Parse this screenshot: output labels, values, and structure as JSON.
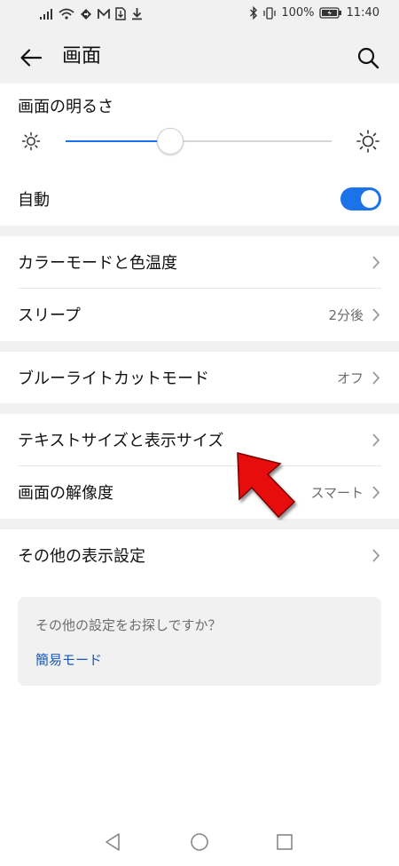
{
  "status_bar": {
    "battery_percent": "100%",
    "time": "11:40",
    "icons": [
      "signal-icon",
      "wifi-icon",
      "direction-icon",
      "mail-icon",
      "sim-icon",
      "download-icon",
      "bluetooth-icon",
      "vibrate-icon",
      "battery-icon"
    ]
  },
  "app_bar": {
    "title": "画面",
    "icons": {
      "back": "back-arrow-icon",
      "search": "search-icon"
    }
  },
  "brightness": {
    "label": "画面の明るさ",
    "slider_value_fraction": 0.39
  },
  "auto": {
    "label": "自動",
    "toggle_on": true
  },
  "sections": {
    "color": {
      "label": "カラーモードと色温度"
    },
    "sleep": {
      "label": "スリープ",
      "value": "2分後"
    },
    "bluelight": {
      "label": "ブルーライトカットモード",
      "value": "オフ"
    },
    "textsize": {
      "label": "テキストサイズと表示サイズ"
    },
    "resolution": {
      "label": "画面の解像度",
      "value": "スマート"
    },
    "other": {
      "label": "その他の表示設定"
    }
  },
  "suggestion": {
    "text": "その他の設定をお探しですか？",
    "link": "簡易モード"
  },
  "colors": {
    "accent_blue": "#1a73e8",
    "link_blue": "#1a57b7",
    "annotation_red": "#e81010",
    "gap_gray": "#f1f1f1"
  }
}
